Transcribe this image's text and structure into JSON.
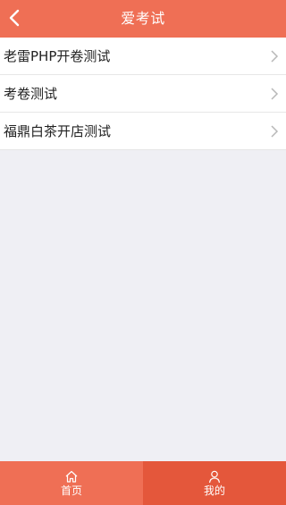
{
  "header": {
    "title": "爱考试",
    "back_icon": "chevron-left-icon"
  },
  "exam_list": [
    {
      "label": "老雷PHP开卷测试"
    },
    {
      "label": "考卷测试"
    },
    {
      "label": "福鼎白茶开店测试"
    }
  ],
  "tabbar": {
    "tabs": [
      {
        "label": "首页",
        "icon": "home-icon",
        "active": false
      },
      {
        "label": "我的",
        "icon": "user-icon",
        "active": true
      }
    ]
  },
  "colors": {
    "accent": "#ef6f55",
    "accent_active": "#e4573b",
    "background": "#efeff4"
  }
}
